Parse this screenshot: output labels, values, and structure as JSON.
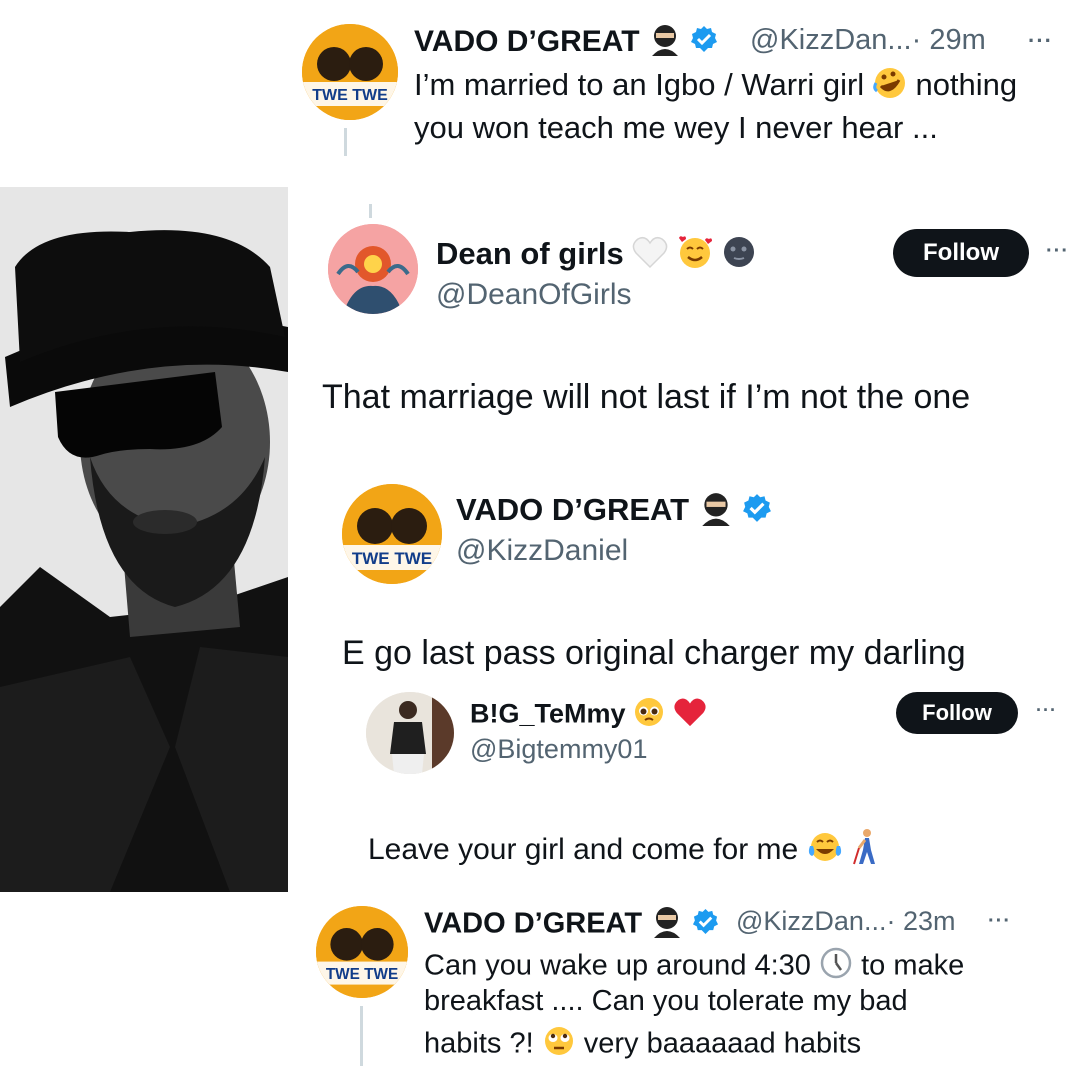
{
  "tweets": {
    "t1": {
      "name": "VADO D’GREAT",
      "handle": "@KizzDan...",
      "time": "· 29m",
      "line1": "I’m married to an Igbo / Warri girl",
      "line1_end": "nothing",
      "line2": "you won teach me wey I never hear ..."
    },
    "t2": {
      "name": "Dean of girls",
      "handle": "@DeanOfGirls",
      "follow_label": "Follow",
      "text": "That  marriage will not last if I’m not the one"
    },
    "t3": {
      "name": "VADO D’GREAT",
      "handle": "@KizzDaniel",
      "text": "E go last pass original charger my darling"
    },
    "t4": {
      "name": "B!G_TeMmy",
      "handle": "@Bigtemmy01",
      "follow_label": "Follow",
      "text": "Leave your girl and come for me"
    },
    "t5": {
      "name": "VADO D’GREAT",
      "handle": "@KizzDan...",
      "time": "· 23m",
      "line1": "Can you wake up around 4:30",
      "line1_end": "to make",
      "line2": "breakfast .... Can you tolerate my bad",
      "line3a": "habits ?!",
      "line3b": "very baaaaaad habits"
    }
  },
  "more_glyph": "···",
  "avatar_logo_text": "TWE TWE",
  "icons": [
    "ninja-emoji-icon",
    "verified-badge-icon",
    "rofl-emoji-icon",
    "white-heart-emoji-icon",
    "smiling-hearts-emoji-icon",
    "new-moon-face-emoji-icon",
    "pleading-face-emoji-icon",
    "red-heart-emoji-icon",
    "tears-of-joy-emoji-icon",
    "person-with-cane-emoji-icon",
    "clock-emoji-icon",
    "eye-roll-emoji-icon",
    "more-options-icon"
  ],
  "colors": {
    "verified": "#1d9bf0",
    "follow_bg": "#0f1419",
    "handle": "#536471",
    "avatar_bg": "#f2a516"
  }
}
